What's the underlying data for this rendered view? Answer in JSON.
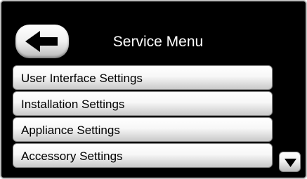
{
  "header": {
    "title": "Service Menu",
    "back_icon": "left-arrow-icon"
  },
  "menu": {
    "items": [
      {
        "label": "User Interface Settings"
      },
      {
        "label": "Installation Settings"
      },
      {
        "label": "Appliance Settings"
      },
      {
        "label": "Accessory Settings"
      }
    ]
  },
  "scroll": {
    "down_icon": "down-triangle-icon"
  },
  "colors": {
    "background": "#000000",
    "button_face": "#f2f2f2",
    "title_text": "#ffffff",
    "button_text": "#000000"
  }
}
